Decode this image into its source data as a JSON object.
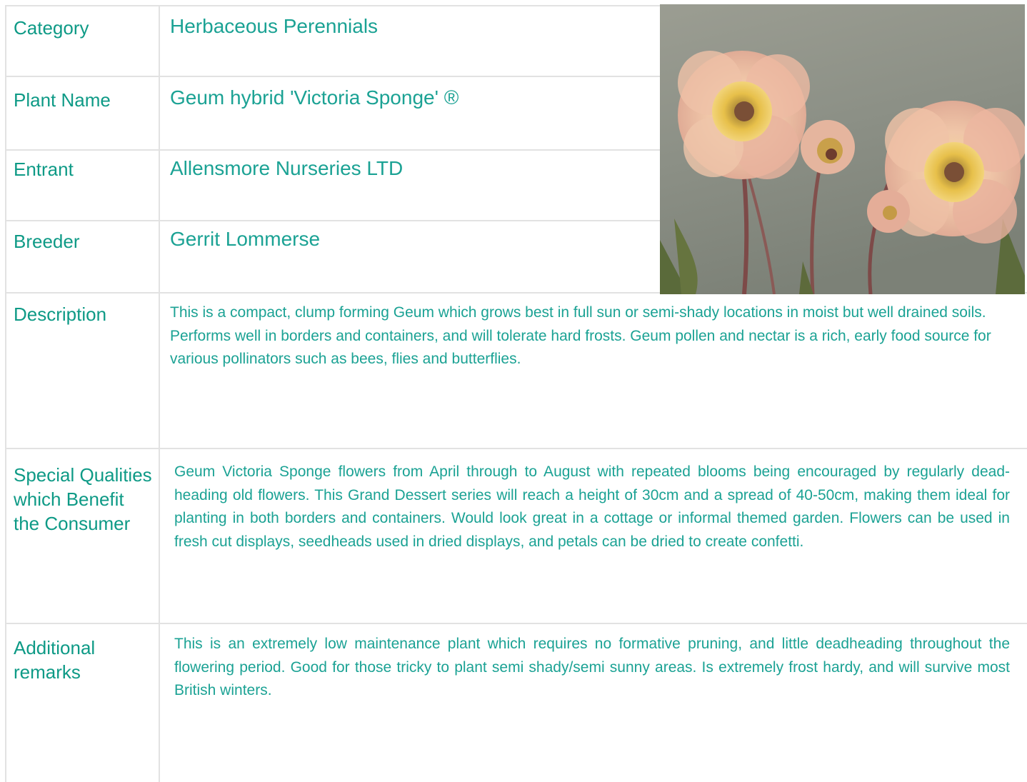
{
  "rows": {
    "category": {
      "label": "Category",
      "value": "Herbaceous Perennials"
    },
    "plant_name": {
      "label": "Plant Name",
      "value": "Geum hybrid 'Victoria Sponge' ®"
    },
    "entrant": {
      "label": "Entrant",
      "value": "Allensmore Nurseries LTD"
    },
    "breeder": {
      "label": "Breeder",
      "value": "Gerrit Lommerse"
    },
    "description": {
      "label": "Description",
      "value": "This is a compact, clump forming Geum which grows best in full sun or semi-shady locations in moist but well drained soils. Performs well in borders and containers, and will tolerate hard frosts. Geum pollen and nectar is a rich, early food source for various pollinators such as bees, flies and butterflies."
    },
    "special_qualities": {
      "label": "Special Qualities which Benefit the Consumer",
      "value": "Geum Victoria Sponge flowers from April through to August with repeated blooms being encouraged by regularly dead-heading old flowers. This Grand Dessert series will reach a height of 30cm and a spread of 40-50cm, making them ideal for planting in both borders and containers. Would look great in a cottage or informal themed garden. Flowers can be used in fresh cut displays, seedheads used in dried displays, and petals can be dried to create confetti."
    },
    "additional_remarks": {
      "label": "Additional remarks",
      "value": "This is an extremely low maintenance plant which requires no formative pruning, and little deadheading throughout the flowering period. Good for those tricky to plant semi shady/semi sunny areas. Is extremely frost hardy, and will survive most British winters."
    }
  },
  "colors": {
    "label_text": "#0e9a86",
    "value_text": "#1ba294",
    "grid_line": "#e2e2e2"
  }
}
